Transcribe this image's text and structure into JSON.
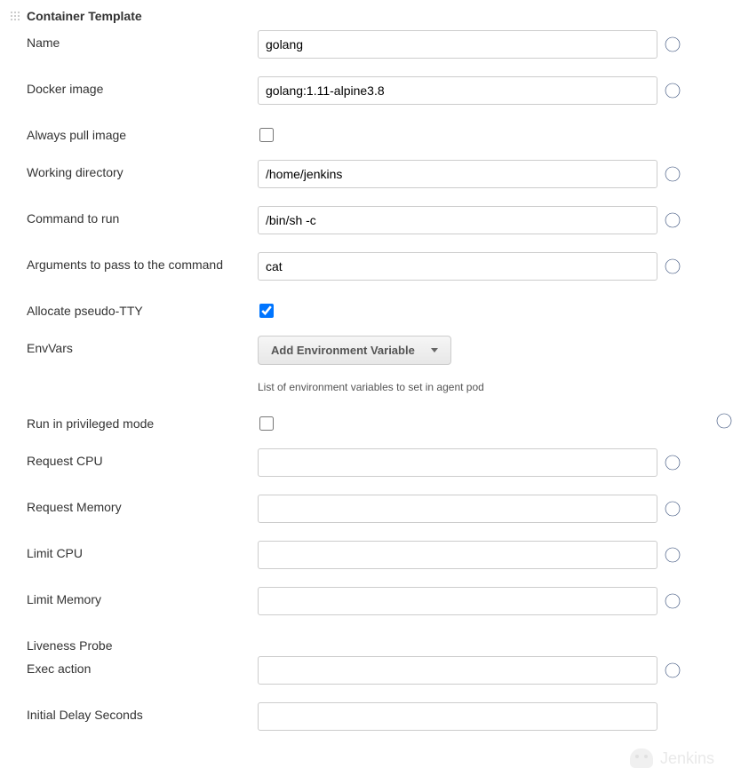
{
  "section": {
    "title": "Container Template"
  },
  "fields": {
    "name": {
      "label": "Name",
      "value": "golang"
    },
    "docker_image": {
      "label": "Docker image",
      "value": "golang:1.11-alpine3.8"
    },
    "always_pull": {
      "label": "Always pull image",
      "checked": false
    },
    "working_dir": {
      "label": "Working directory",
      "value": "/home/jenkins"
    },
    "command": {
      "label": "Command to run",
      "value": "/bin/sh -c"
    },
    "arguments": {
      "label": "Arguments to pass to the command",
      "value": "cat"
    },
    "allocate_tty": {
      "label": "Allocate pseudo-TTY",
      "checked": true
    },
    "envvars": {
      "label": "EnvVars",
      "button": "Add Environment Variable",
      "hint": "List of environment variables to set in agent pod"
    },
    "privileged": {
      "label": "Run in privileged mode",
      "checked": false
    },
    "request_cpu": {
      "label": "Request CPU",
      "value": ""
    },
    "request_memory": {
      "label": "Request Memory",
      "value": ""
    },
    "limit_cpu": {
      "label": "Limit CPU",
      "value": ""
    },
    "limit_memory": {
      "label": "Limit Memory",
      "value": ""
    },
    "liveness_probe": {
      "label": "Liveness Probe"
    },
    "exec_action": {
      "label": "Exec action",
      "value": ""
    },
    "initial_delay": {
      "label": "Initial Delay Seconds",
      "value": ""
    }
  },
  "watermark": "Jenkins"
}
